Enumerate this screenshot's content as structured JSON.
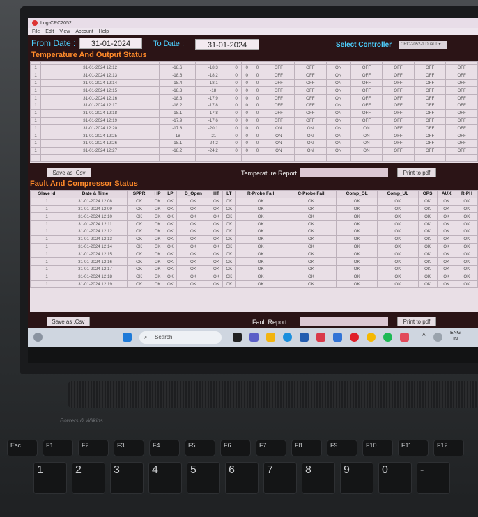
{
  "window": {
    "title": "Log-CRC2052",
    "menu": [
      "File",
      "Edit",
      "View",
      "Account",
      "Help"
    ]
  },
  "filters": {
    "from_label": "From Date :",
    "from_value": "31-01-2024",
    "to_label": "To Date :",
    "to_value": "31-01-2024",
    "controller_label": "Select Controller",
    "controller_value": "CRC-2052-1 Dual T"
  },
  "temperature": {
    "title": "Temperature And Output Status",
    "rows": [
      [
        "1",
        "31-01-2024 12:12",
        "-18.6",
        "-18.3",
        "0",
        "0",
        "0",
        "OFF",
        "OFF",
        "ON",
        "OFF",
        "OFF",
        "OFF",
        "OFF"
      ],
      [
        "1",
        "31-01-2024 12:13",
        "-18.6",
        "-18.2",
        "0",
        "0",
        "0",
        "OFF",
        "OFF",
        "ON",
        "OFF",
        "OFF",
        "OFF",
        "OFF"
      ],
      [
        "1",
        "31-01-2024 12:14",
        "-18.4",
        "-18.1",
        "0",
        "0",
        "0",
        "OFF",
        "OFF",
        "ON",
        "OFF",
        "OFF",
        "OFF",
        "OFF"
      ],
      [
        "1",
        "31-01-2024 12:15",
        "-18.3",
        "-18",
        "0",
        "0",
        "0",
        "OFF",
        "OFF",
        "ON",
        "OFF",
        "OFF",
        "OFF",
        "OFF"
      ],
      [
        "1",
        "31-01-2024 12:16",
        "-18.3",
        "-17.9",
        "0",
        "0",
        "0",
        "OFF",
        "OFF",
        "ON",
        "OFF",
        "OFF",
        "OFF",
        "OFF"
      ],
      [
        "1",
        "31-01-2024 12:17",
        "-18.2",
        "-17.8",
        "0",
        "0",
        "0",
        "OFF",
        "OFF",
        "ON",
        "OFF",
        "OFF",
        "OFF",
        "OFF"
      ],
      [
        "1",
        "31-01-2024 12:18",
        "-18.1",
        "-17.8",
        "0",
        "0",
        "0",
        "OFF",
        "OFF",
        "ON",
        "OFF",
        "OFF",
        "OFF",
        "OFF"
      ],
      [
        "1",
        "31-01-2024 12:19",
        "-17.9",
        "-17.6",
        "0",
        "0",
        "0",
        "OFF",
        "OFF",
        "ON",
        "OFF",
        "OFF",
        "OFF",
        "OFF"
      ],
      [
        "1",
        "31-01-2024 12:20",
        "-17.8",
        "-20.1",
        "0",
        "0",
        "0",
        "ON",
        "ON",
        "ON",
        "ON",
        "OFF",
        "OFF",
        "OFF"
      ],
      [
        "1",
        "31-01-2024 12:25",
        "-18",
        "-21",
        "0",
        "0",
        "0",
        "ON",
        "ON",
        "ON",
        "ON",
        "OFF",
        "OFF",
        "OFF"
      ],
      [
        "1",
        "31-01-2024 12:26",
        "-18.1",
        "-24.2",
        "0",
        "0",
        "0",
        "ON",
        "ON",
        "ON",
        "ON",
        "OFF",
        "OFF",
        "OFF"
      ],
      [
        "1",
        "31-01-2024 12:27",
        "-18.2",
        "-24.2",
        "0",
        "0",
        "0",
        "ON",
        "ON",
        "ON",
        "ON",
        "OFF",
        "OFF",
        "OFF"
      ]
    ],
    "save_label": "Save as .Csv",
    "report_label": "Temperature Report",
    "print_label": "Print to pdf"
  },
  "fault": {
    "title": "Fault And Compressor Status",
    "headers": [
      "Slave Id",
      "Date & Time",
      "SPPR",
      "HP",
      "LP",
      "D_Open",
      "HT",
      "LT",
      "R-Probe Fail",
      "C-Probe Fail",
      "Comp_OL",
      "Comp_UL",
      "OPS",
      "AUX",
      "R-PH"
    ],
    "rows": [
      [
        "1",
        "31-01-2024 12:08",
        "OK",
        "OK",
        "OK",
        "OK",
        "OK",
        "OK",
        "OK",
        "OK",
        "OK",
        "OK",
        "OK",
        "OK",
        "OK"
      ],
      [
        "1",
        "31-01-2024 12:09",
        "OK",
        "OK",
        "OK",
        "OK",
        "OK",
        "OK",
        "OK",
        "OK",
        "OK",
        "OK",
        "OK",
        "OK",
        "OK"
      ],
      [
        "1",
        "31-01-2024 12:10",
        "OK",
        "OK",
        "OK",
        "OK",
        "OK",
        "OK",
        "OK",
        "OK",
        "OK",
        "OK",
        "OK",
        "OK",
        "OK"
      ],
      [
        "1",
        "31-01-2024 12:11",
        "OK",
        "OK",
        "OK",
        "OK",
        "OK",
        "OK",
        "OK",
        "OK",
        "OK",
        "OK",
        "OK",
        "OK",
        "OK"
      ],
      [
        "1",
        "31-01-2024 12:12",
        "OK",
        "OK",
        "OK",
        "OK",
        "OK",
        "OK",
        "OK",
        "OK",
        "OK",
        "OK",
        "OK",
        "OK",
        "OK"
      ],
      [
        "1",
        "31-01-2024 12:13",
        "OK",
        "OK",
        "OK",
        "OK",
        "OK",
        "OK",
        "OK",
        "OK",
        "OK",
        "OK",
        "OK",
        "OK",
        "OK"
      ],
      [
        "1",
        "31-01-2024 12:14",
        "OK",
        "OK",
        "OK",
        "OK",
        "OK",
        "OK",
        "OK",
        "OK",
        "OK",
        "OK",
        "OK",
        "OK",
        "OK"
      ],
      [
        "1",
        "31-01-2024 12:15",
        "OK",
        "OK",
        "OK",
        "OK",
        "OK",
        "OK",
        "OK",
        "OK",
        "OK",
        "OK",
        "OK",
        "OK",
        "OK"
      ],
      [
        "1",
        "31-01-2024 12:16",
        "OK",
        "OK",
        "OK",
        "OK",
        "OK",
        "OK",
        "OK",
        "OK",
        "OK",
        "OK",
        "OK",
        "OK",
        "OK"
      ],
      [
        "1",
        "31-01-2024 12:17",
        "OK",
        "OK",
        "OK",
        "OK",
        "OK",
        "OK",
        "OK",
        "OK",
        "OK",
        "OK",
        "OK",
        "OK",
        "OK"
      ],
      [
        "1",
        "31-01-2024 12:18",
        "OK",
        "OK",
        "OK",
        "OK",
        "OK",
        "OK",
        "OK",
        "OK",
        "OK",
        "OK",
        "OK",
        "OK",
        "OK"
      ],
      [
        "1",
        "31-01-2024 12:19",
        "OK",
        "OK",
        "OK",
        "OK",
        "OK",
        "OK",
        "OK",
        "OK",
        "OK",
        "OK",
        "OK",
        "OK",
        "OK"
      ]
    ],
    "save_label": "Save as .Csv",
    "report_label": "Fault Report",
    "print_label": "Print to pdf"
  },
  "taskbar": {
    "search_placeholder": "Search",
    "lang": "ENG",
    "region": "IN"
  },
  "laptop": {
    "brand": "Bowers & Wilkins",
    "keys_fn": [
      "Esc",
      "F1",
      "F2",
      "F3",
      "F4",
      "F5",
      "F6",
      "F7",
      "F8",
      "F9",
      "F10",
      "F11",
      "F12"
    ],
    "keys_num": [
      "1",
      "2",
      "3",
      "4",
      "5",
      "6",
      "7",
      "8",
      "9",
      "0",
      "-"
    ]
  }
}
